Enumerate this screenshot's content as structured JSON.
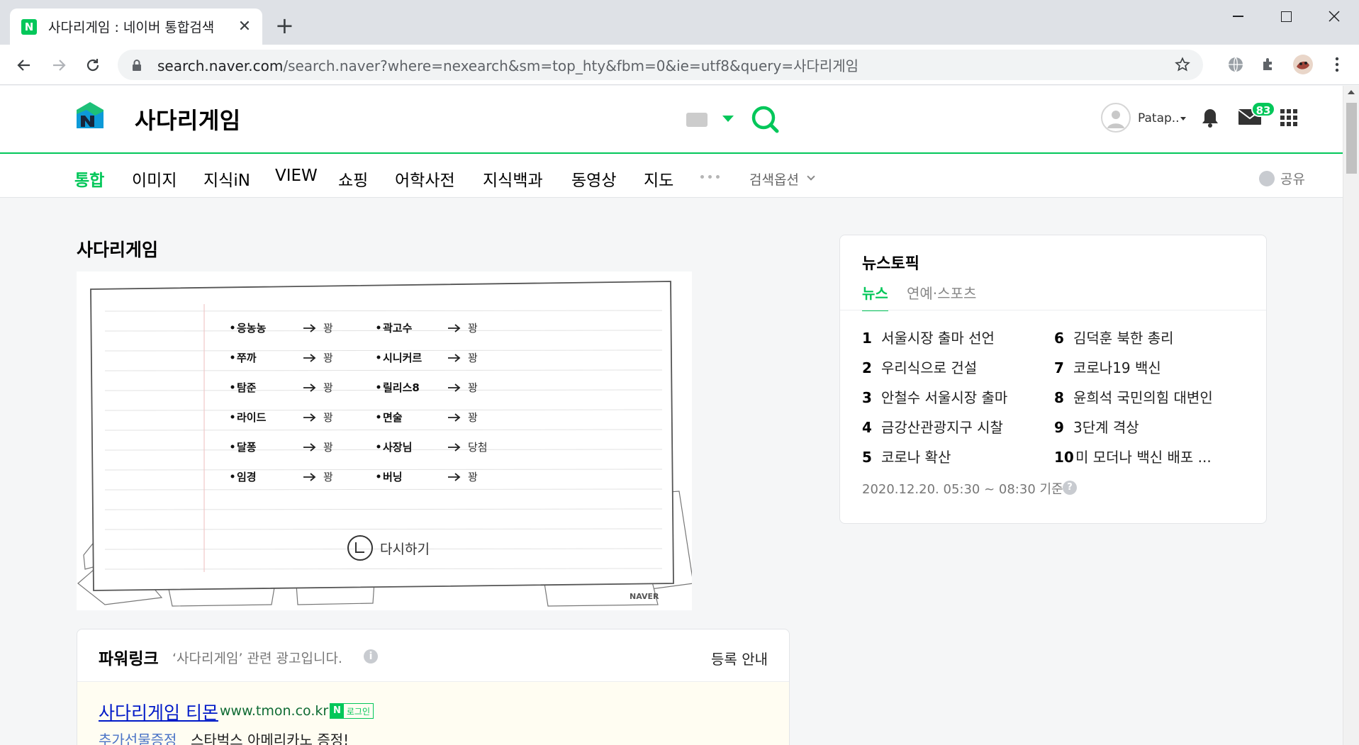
{
  "browser": {
    "tab_title": "사다리게임 : 네이버 통합검색",
    "url_host": "search.naver.com",
    "url_path": "/search.naver?where=nexearch&sm=top_hty&fbm=0&ie=utf8&query=사다리게임"
  },
  "header": {
    "query": "사다리게임",
    "user_name": "Patap..",
    "mail_count": "83"
  },
  "lnb": {
    "items": [
      "통합",
      "이미지",
      "지식iN",
      "VIEW",
      "쇼핑",
      "어학사전",
      "지식백과",
      "동영상",
      "지도"
    ],
    "search_option": "검색옵션",
    "share": "공유"
  },
  "result": {
    "title": "사다리게임",
    "ladder": {
      "left": [
        {
          "name": "응농농",
          "result": "꽝"
        },
        {
          "name": "쭈까",
          "result": "꽝"
        },
        {
          "name": "탐준",
          "result": "꽝"
        },
        {
          "name": "라이드",
          "result": "꽝"
        },
        {
          "name": "달퐁",
          "result": "꽝"
        },
        {
          "name": "임경",
          "result": "꽝"
        }
      ],
      "right": [
        {
          "name": "곽고수",
          "result": "꽝"
        },
        {
          "name": "시니커르",
          "result": "꽝"
        },
        {
          "name": "릴리스8",
          "result": "꽝"
        },
        {
          "name": "면술",
          "result": "꽝"
        },
        {
          "name": "사장님",
          "result": "당첨"
        },
        {
          "name": "버닝",
          "result": "꽝"
        }
      ],
      "retry": "다시하기",
      "watermark": "NAVER"
    }
  },
  "powerlink": {
    "title": "파워링크",
    "subtitle": "‘사다리게임’ 관련 광고입니다.",
    "register": "등록 안내",
    "ad": {
      "title": "사다리게임 티몬",
      "url": "www.tmon.co.kr",
      "login_n": "N",
      "login_label": "로그인",
      "desc_highlight": "추가선물증정",
      "desc": "스타벅스 아메리카노 증정!"
    }
  },
  "newstopic": {
    "title": "뉴스토픽",
    "tabs": [
      "뉴스",
      "연예·스포츠"
    ],
    "items": [
      {
        "rank": "1",
        "text": "서울시장 출마 선언"
      },
      {
        "rank": "2",
        "text": "우리식으로 건설"
      },
      {
        "rank": "3",
        "text": "안철수 서울시장 출마"
      },
      {
        "rank": "4",
        "text": "금강산관광지구 시찰"
      },
      {
        "rank": "5",
        "text": "코로나 확산"
      },
      {
        "rank": "6",
        "text": "김덕훈 북한 총리"
      },
      {
        "rank": "7",
        "text": "코로나19 백신"
      },
      {
        "rank": "8",
        "text": "윤희석 국민의힘 대변인"
      },
      {
        "rank": "9",
        "text": "3단계 격상"
      },
      {
        "rank": "10",
        "text": "미 모더나 백신 배포 ..."
      }
    ],
    "time": "2020.12.20. 05:30 ~ 08:30 기준",
    "help": "?"
  },
  "colors": {
    "brand": "#03c75a",
    "link": "#0019c8"
  }
}
